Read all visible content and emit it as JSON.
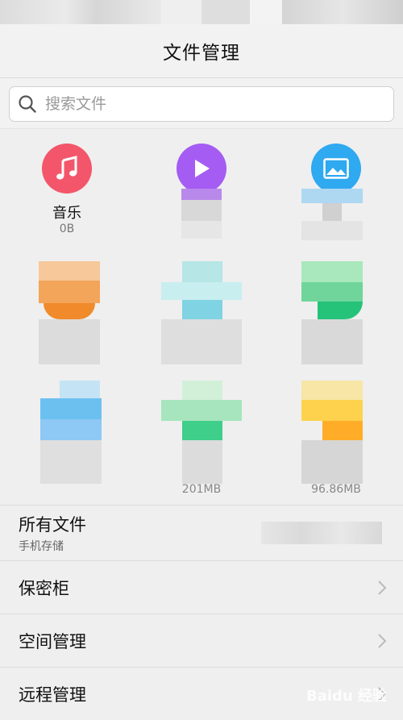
{
  "header": {
    "title": "文件管理"
  },
  "search": {
    "placeholder": "搜索文件"
  },
  "categories": [
    {
      "label": "音乐",
      "size": "0B"
    }
  ],
  "sizes": {
    "s8": "201MB",
    "s9": "96.86MB"
  },
  "list": {
    "all_files": {
      "label": "所有文件",
      "sub": "手机存储"
    },
    "safe": {
      "label": "保密柜"
    },
    "space": {
      "label": "空间管理"
    },
    "remote": {
      "label": "远程管理"
    }
  },
  "watermark": "Baidu 经验",
  "colors": {
    "music": "#f3566a",
    "video": "#a55cf2",
    "image": "#2fa9f0"
  }
}
